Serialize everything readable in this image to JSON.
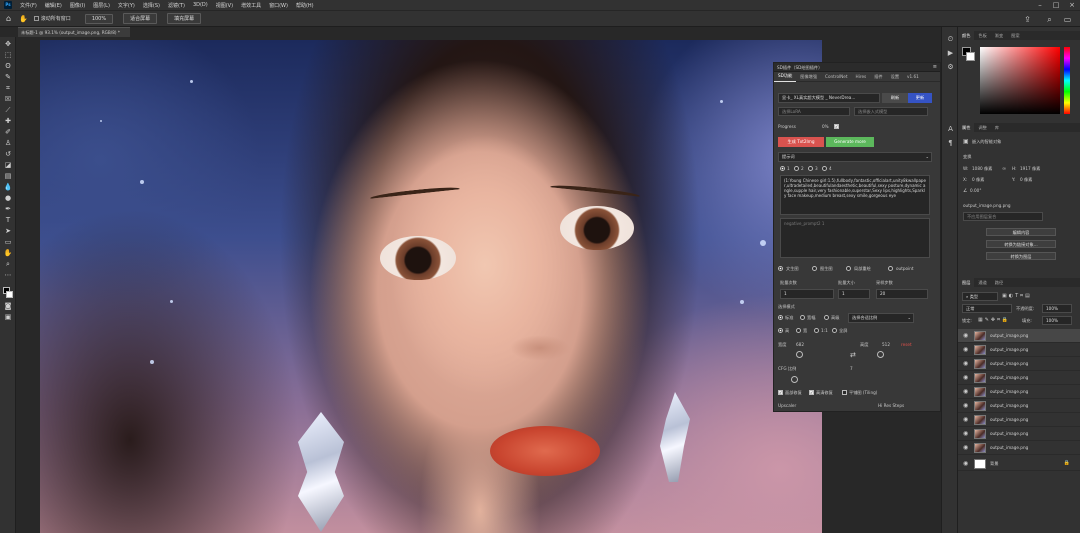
{
  "app": {
    "logo": "Ps"
  },
  "menubar": {
    "items": [
      "文件(F)",
      "编辑(E)",
      "图像(I)",
      "图层(L)",
      "文字(Y)",
      "选择(S)",
      "滤镜(T)",
      "3D(D)",
      "视图(V)",
      "增效工具",
      "窗口(W)",
      "帮助(H)"
    ]
  },
  "optionsbar": {
    "scroll_all": "滚动所有窗口",
    "zoom": "100%",
    "fit_screen": "适合屏幕",
    "fill_screen": "填充屏幕"
  },
  "document": {
    "tab_title": "未标题-1 @ 93.1% (output_image.png, RGB/8) *"
  },
  "sd_panel": {
    "title": "SD插件（SD绘图插件）",
    "tabs": [
      "SD功能",
      "图像增强",
      "ControlNet",
      "Hires",
      "插件",
      "设置",
      "v1.61"
    ],
    "model": "显卡_ XL真实超大模型 _ NeverDrea...",
    "refresh_btn": "刷新",
    "update_btn": "更新",
    "lora": "选择LoRA",
    "emb": "选择嵌入式模型",
    "progress_label": "Progress",
    "progress_value": "0%",
    "generate_btn": "生成 Txt2Img",
    "generate_more_btn": "Generate more",
    "prompt_section": "提示词",
    "prompt_tabs": [
      "1",
      "2",
      "3",
      "4"
    ],
    "prompt_text": "(1:Young Chinese girl:1.5),fullbody,fantastic,officialart,unity8kwallpaper,ultradetailed,beautifulandaesthetic,beautiful,sexy posture,dynamic angle,supple hair,very fashionable,superstar,Sexy lips,highlights,Sparkly face makeup,medium breast,sexy smile,gorgeous eye",
    "negative_placeholder": "negative_prompt2 1",
    "modes": [
      "文生图",
      "图生图",
      "局部重绘",
      "outpoint"
    ],
    "batch_count_label": "批量次数",
    "batch_size_label": "批量大小",
    "steps_label": "采样步数",
    "batch_count": "1",
    "batch_size": "1",
    "steps": "20",
    "mode_label": "选择模式",
    "mode_opts": [
      "标准",
      "宽幅",
      "高级"
    ],
    "sampler": "选择合适比例",
    "size_opts": [
      "高",
      "宽",
      "1:1",
      "全屏"
    ],
    "width_label": "宽度",
    "width": "682",
    "height_label": "高度",
    "height": "512",
    "reset": "reset",
    "cfg_label": "CFG 比例",
    "cfg_value": "7",
    "chk_labels": [
      "面部修复",
      "高清修复",
      "平铺图 (Tiling)"
    ],
    "upscaler_label": "Upscaler",
    "hires_steps": "Hi Res Steps"
  },
  "right_panel": {
    "color_tabs": [
      "颜色",
      "色板",
      "渐变",
      "图案"
    ],
    "props_tabs": [
      "属性",
      "调整",
      "库"
    ],
    "props_type": "嵌入的智能对象",
    "transform_label": "变换",
    "w_label": "W:",
    "w_value": "1080 像素",
    "h_label": "H:",
    "h_value": "1917 像素",
    "x_label": "X:",
    "x_value": "0 像素",
    "y_label": "Y:",
    "y_value": "0 像素",
    "angle": "0.00°",
    "file_name": "output_image.png.png",
    "no_comp": "不应用图层复合",
    "btn_edit": "编辑内容",
    "btn_convert_linked": "转换为链接对象...",
    "btn_convert_layers": "转换为图层",
    "layers_tabs": [
      "图层",
      "通道",
      "路径"
    ],
    "filter_kind": "类型",
    "blend_mode": "正常",
    "opacity_label": "不透明度:",
    "opacity": "100%",
    "lock_label": "锁定:",
    "fill_label": "填充:",
    "fill": "100%",
    "layers": [
      "output_image.png",
      "output_image.png",
      "output_image.png",
      "output_image.png",
      "output_image.png",
      "output_image.png",
      "output_image.png",
      "output_image.png",
      "output_image.png",
      "背景"
    ]
  }
}
